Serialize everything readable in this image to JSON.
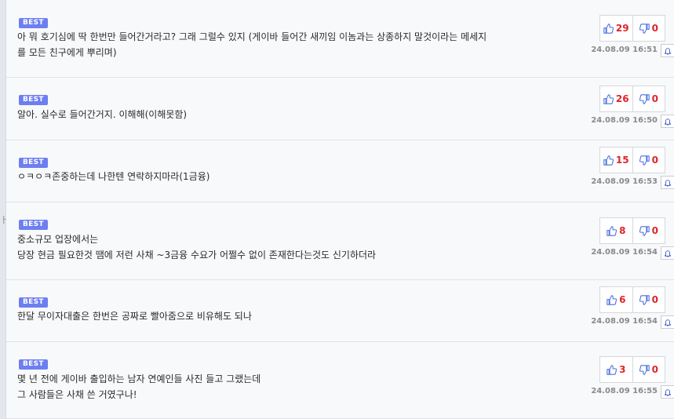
{
  "comments": [
    {
      "badge": "BEST",
      "text": "아 뭐 호기심에 딱 한번만 들어간거라고? 그래 그럴수 있지 (게이바 들어간 새끼임 이놈과는 상종하지 말것이라는 메세지\n를 모든 친구에게 뿌리며)",
      "up": "29",
      "down": "0",
      "date": "24.08.09 16:51"
    },
    {
      "badge": "BEST",
      "text": "알아. 실수로 들어간거지. 이해해(이해못함)",
      "up": "26",
      "down": "0",
      "date": "24.08.09 16:50"
    },
    {
      "badge": "BEST",
      "text": "ㅇㅋㅇㅋ존중하는데 나한텐 연락하지마라(1금융)",
      "up": "15",
      "down": "0",
      "date": "24.08.09 16:53"
    },
    {
      "badge": "BEST",
      "text": "중소규모 업장에서는\n당장 현금 필요한것 땜에 저런 사채 ~3금융 수요가 어쩔수 없이 존재한다는것도 신기하더라",
      "up": "8",
      "down": "0",
      "date": "24.08.09 16:54"
    },
    {
      "badge": "BEST",
      "text": "한달 무이자대출은 한번은 공짜로 빨아줌으로 비유해도 되나",
      "up": "6",
      "down": "0",
      "date": "24.08.09 16:54"
    },
    {
      "badge": "BEST",
      "text": "몇 년 전에 게이바 출입하는 남자 연예인들 사진 들고 그랬는데\n그 사람들은 사채 쓴 거였구나!",
      "up": "3",
      "down": "0",
      "date": "24.08.09 16:55"
    }
  ],
  "left_mark": "ㅏ",
  "colors": {
    "badge": "#6d7ff0",
    "vote_count": "#e0242a",
    "thumb_up": "#4a6ee0",
    "thumb_down": "#4a6ee0"
  }
}
